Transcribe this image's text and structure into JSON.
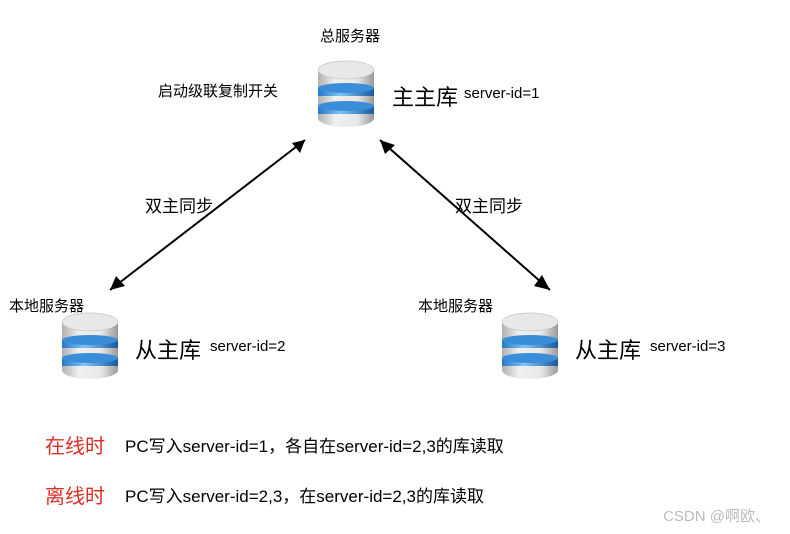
{
  "top": {
    "server_label": "总服务器",
    "switch_label": "启动级联复制开关",
    "db_name": "主主库",
    "server_id": "server-id=1"
  },
  "left": {
    "sync_label": "双主同步",
    "server_label": "本地服务器",
    "db_name": "从主库",
    "server_id": "server-id=2"
  },
  "right": {
    "sync_label": "双主同步",
    "server_label": "本地服务器",
    "db_name": "从主库",
    "server_id": "server-id=3"
  },
  "bottom": {
    "online_label": "在线时",
    "online_desc": "PC写入server-id=1，各自在server-id=2,3的库读取",
    "offline_label": "离线时",
    "offline_desc": "PC写入server-id=2,3，在server-id=2,3的库读取"
  },
  "watermark": "CSDN @啊欧、"
}
